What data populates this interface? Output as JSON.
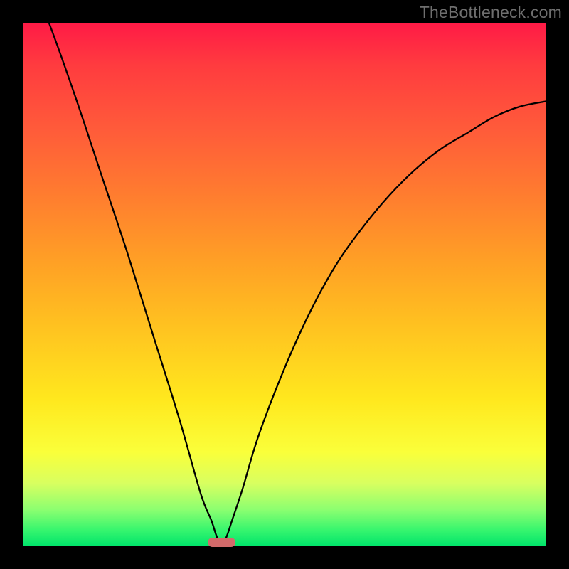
{
  "watermark": "TheBottleneck.com",
  "chart_data": {
    "type": "line",
    "title": "",
    "xlabel": "",
    "ylabel": "",
    "xlim": [
      0,
      100
    ],
    "ylim": [
      0,
      100
    ],
    "grid": false,
    "legend": false,
    "note": "Axes unlabeled; values are normalized plot-area percentages estimated from the image. y = bottleneck %, minimum at x≈38.",
    "series": [
      {
        "name": "bottleneck-curve",
        "x": [
          0,
          5,
          10,
          15,
          20,
          25,
          30,
          34,
          36,
          37,
          38,
          39,
          40,
          42,
          45,
          50,
          55,
          60,
          65,
          70,
          75,
          80,
          85,
          90,
          95,
          100
        ],
        "values": [
          112,
          100,
          86,
          71,
          56,
          40,
          24,
          10,
          5,
          2,
          0,
          2,
          5,
          11,
          21,
          34,
          45,
          54,
          61,
          67,
          72,
          76,
          79,
          82,
          84,
          85
        ]
      }
    ],
    "marker": {
      "name": "minimum-marker",
      "x_center": 38,
      "y": 0,
      "width_pct": 5.2,
      "color": "#d26a6a"
    },
    "background_gradient": {
      "top": "#ff1a46",
      "upper_mid": "#ffa125",
      "lower_mid": "#ffe81e",
      "bottom": "#00e46b"
    }
  }
}
